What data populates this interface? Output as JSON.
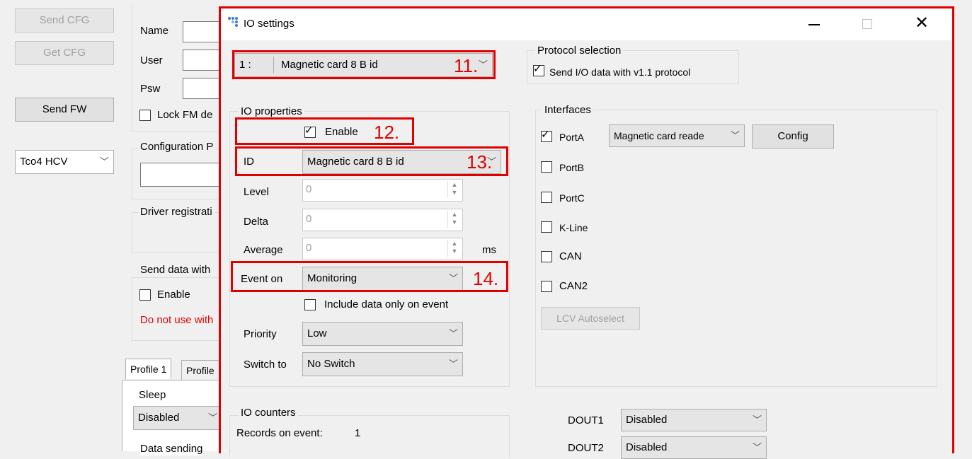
{
  "left_panel": {
    "send_cfg": "Send CFG",
    "get_cfg": "Get CFG",
    "send_fw": "Send FW",
    "device_select": "Tco4 HCV",
    "name_label": "Name",
    "user_label": "User",
    "psw_label": "Psw",
    "lock_label": "Lock FM de",
    "config_group": "Configuration P",
    "driver_group": "Driver registrati",
    "send_data_group": "Send data with",
    "enable_label": "Enable",
    "warning": "Do not use with",
    "tab_profile1": "Profile 1",
    "tab_profile2": "Profile",
    "sleep_group": "Sleep",
    "sleep_value": "Disabled",
    "data_sending": "Data sending"
  },
  "dialog": {
    "title": "IO settings",
    "io_select_index": "1 :",
    "io_select_value": "Magnetic card 8 B id",
    "protocol_group": "Protocol selection",
    "protocol_checkbox": "Send I/O data with v1.1 protocol",
    "io_properties_group": "IO properties",
    "enable_label": "Enable",
    "id_label": "ID",
    "id_value": "Magnetic card 8 B id",
    "level_label": "Level",
    "level_value": "0",
    "delta_label": "Delta",
    "delta_value": "0",
    "average_label": "Average",
    "average_value": "0",
    "average_unit": "ms",
    "event_on_label": "Event on",
    "event_on_value": "Monitoring",
    "include_data_label": "Include data only on event",
    "priority_label": "Priority",
    "priority_value": "Low",
    "switch_to_label": "Switch to",
    "switch_to_value": "No Switch",
    "interfaces_group": "Interfaces",
    "porta_label": "PortA",
    "porta_value": "Magnetic card reade",
    "config_button": "Config",
    "portb_label": "PortB",
    "portc_label": "PortC",
    "kline_label": "K-Line",
    "can_label": "CAN",
    "can2_label": "CAN2",
    "lcv_button": "LCV Autoselect",
    "io_counters_group": "IO counters",
    "records_label": "Records on event:",
    "records_value": "1",
    "dout1_label": "DOUT1",
    "dout1_value": "Disabled",
    "dout2_label": "DOUT2",
    "dout2_value": "Disabled"
  },
  "annotations": {
    "n11": "11.",
    "n12": "12.",
    "n13": "13.",
    "n14": "14."
  },
  "colors": {
    "highlight": "#e00000",
    "window_bg": "#f0f0f0"
  }
}
